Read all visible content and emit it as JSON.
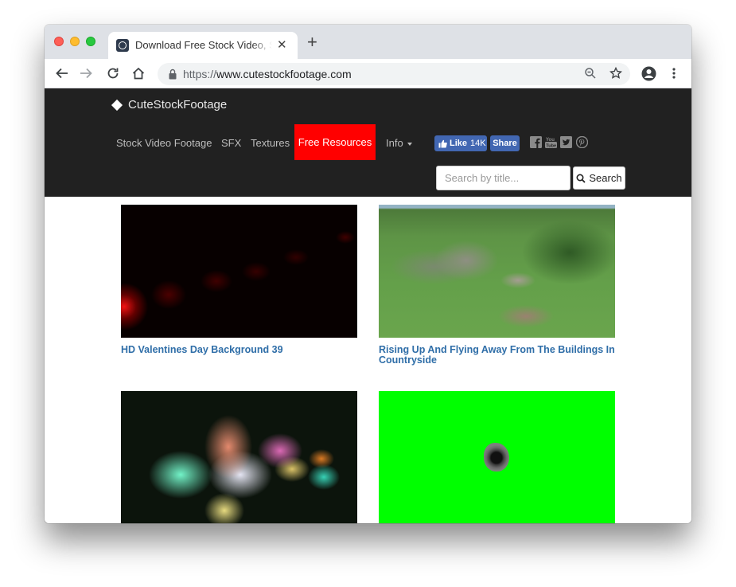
{
  "browser": {
    "tab_title": "Download Free Stock Video, Sound Effects and Textures",
    "tab_close": "✕",
    "new_tab": "+",
    "url_scheme": "https://",
    "url_host": "www.cutestockfootage.com"
  },
  "site": {
    "logo_text": "CuteStockFootage",
    "nav": {
      "stock_video": "Stock Video Footage",
      "sfx": "SFX",
      "textures": "Textures",
      "free_resources": "Free Resources",
      "info": "Info"
    },
    "facebook": {
      "like_label": "Like",
      "like_count": "14K",
      "share_label": "Share"
    },
    "social_icons": [
      "facebook-icon",
      "youtube-icon",
      "twitter-icon",
      "pinterest-icon"
    ],
    "search": {
      "placeholder": "Search by title...",
      "button_label": "Search"
    },
    "colors": {
      "header_bg": "#212121",
      "active_nav_bg": "#ff0000",
      "caption_link": "#2f6ea8",
      "facebook_blue": "#4267b2"
    }
  },
  "videos": [
    {
      "title": "HD Valentines Day Background 39"
    },
    {
      "title": "Rising Up And Flying Away From The Buildings In Countryside"
    },
    {
      "title": ""
    },
    {
      "title": ""
    }
  ]
}
